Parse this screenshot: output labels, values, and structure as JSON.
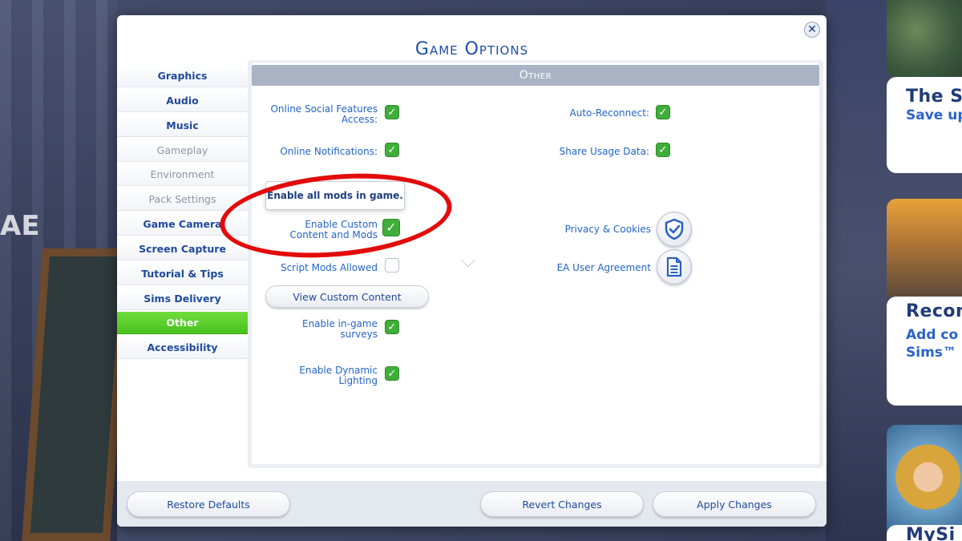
{
  "dialog": {
    "title": "Game Options",
    "close_label": "✕"
  },
  "sidebar": {
    "items": [
      {
        "label": "Graphics",
        "state": "normal"
      },
      {
        "label": "Audio",
        "state": "normal"
      },
      {
        "label": "Music",
        "state": "normal"
      },
      {
        "label": "Gameplay",
        "state": "disabled"
      },
      {
        "label": "Environment",
        "state": "disabled"
      },
      {
        "label": "Pack Settings",
        "state": "disabled"
      },
      {
        "label": "Game Camera",
        "state": "normal"
      },
      {
        "label": "Screen Capture",
        "state": "normal"
      },
      {
        "label": "Tutorial & Tips",
        "state": "normal"
      },
      {
        "label": "Sims Delivery",
        "state": "normal"
      },
      {
        "label": "Other",
        "state": "active"
      },
      {
        "label": "Accessibility",
        "state": "normal"
      }
    ]
  },
  "section": {
    "header": "Other"
  },
  "options": {
    "online_social": {
      "label_line1": "Online Social Features",
      "label_line2": "Access:",
      "checked": true
    },
    "online_notifications": {
      "label": "Online Notifications:",
      "checked": true
    },
    "custom_content": {
      "label_line1": "Enable Custom",
      "label_line2": "Content and Mods",
      "checked": true
    },
    "script_mods": {
      "label": "Script Mods Allowed",
      "checked": false
    },
    "in_game_surveys": {
      "label_line1": "Enable in-game",
      "label_line2": "surveys",
      "checked": true
    },
    "dynamic_lighting": {
      "label_line1": "Enable Dynamic",
      "label_line2": "Lighting",
      "checked": true
    },
    "auto_reconnect": {
      "label": "Auto-Reconnect:",
      "checked": true
    },
    "share_usage": {
      "label": "Share Usage Data:",
      "checked": true
    }
  },
  "tooltip": {
    "text": "Enable all mods in game."
  },
  "links": {
    "privacy": "Privacy & Cookies",
    "ea_agreement": "EA User Agreement"
  },
  "buttons": {
    "view_custom_content": "View Custom Content",
    "restore_defaults": "Restore Defaults",
    "revert_changes": "Revert Changes",
    "apply_changes": "Apply Changes"
  },
  "background": {
    "partial_letter": "AE",
    "promo_1_title": "The Si",
    "promo_1_sub": "Save up",
    "promo_2_title": "Recom",
    "promo_2_sub1": "Add co",
    "promo_2_sub2": "Sims™",
    "promo_3_title": "MySi"
  },
  "colors": {
    "accent_blue": "#2364c7",
    "active_green": "#49c21d",
    "annotation_red": "#e30b0b"
  }
}
